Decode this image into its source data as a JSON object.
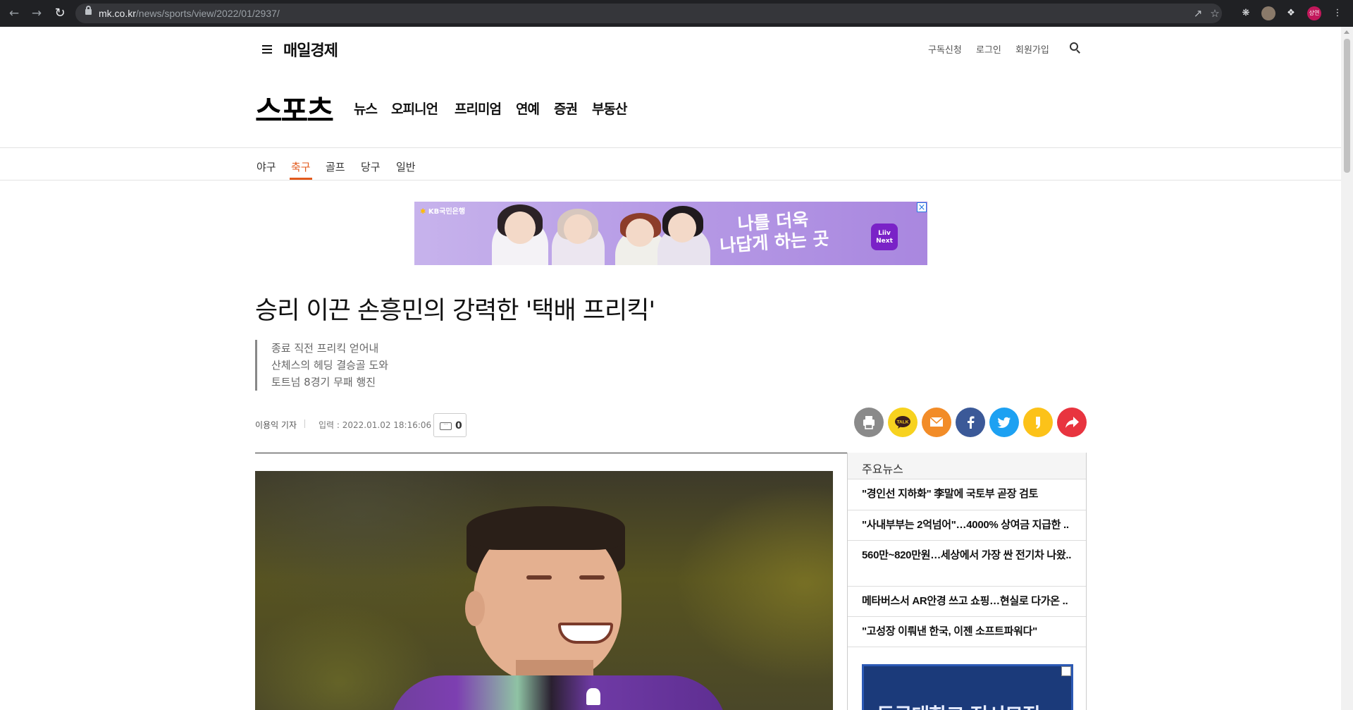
{
  "browser": {
    "url_host": "mk.co.kr",
    "url_path": "/news/sports/view/2022/01/2937/",
    "profile_initials": "상연"
  },
  "site": {
    "logo": "매일경제",
    "util_links": [
      "구독신청",
      "로그인",
      "회원가입"
    ],
    "section_title": "스포츠",
    "section_nav": [
      "뉴스",
      "오피니언",
      "프리미엄",
      "연예",
      "증권",
      "부동산"
    ],
    "sub_nav": [
      "야구",
      "축구",
      "골프",
      "당구",
      "일반"
    ],
    "active_sub": "축구",
    "accent_color": "#e25a1c"
  },
  "ad_banner": {
    "bank": "KB국민은행",
    "headline_line1": "나를 더욱",
    "headline_line2": "나답게 하는 곳",
    "brand_line1": "Liiv",
    "brand_line2": "Next"
  },
  "article": {
    "title": "승리 이끈 손흥민의 강력한 '택배 프리킥'",
    "summary": [
      "종료 직전 프리킥 얻어내",
      "산체스의 헤딩 결승골 도와",
      "토트넘 8경기 무패 행진"
    ],
    "reporter": "이용익 기자",
    "date": "입력 : 2022.01.02 18:16:06",
    "comment_count": "0"
  },
  "share": {
    "icons": [
      "print-icon",
      "kakaotalk-icon",
      "email-icon",
      "facebook-icon",
      "twitter-icon",
      "kakaostory-icon",
      "share-icon"
    ],
    "talk_label": "TALK"
  },
  "sidebar": {
    "title": "주요뉴스",
    "news": [
      "\"경인선 지하화\" 李말에 국토부 곧장 검토",
      "\"사내부부는 2억넘어\"…4000% 상여금 지급한 ..",
      "560만~820만원…세상에서 가장 싼 전기차 나왔..",
      "메타버스서 AR안경 쓰고 쇼핑…현실로 다가온 ..",
      "\"고성장 이뤄낸 한국, 이젠 소프트파워다\""
    ],
    "ad_text": "동국대학교 정시모집"
  }
}
